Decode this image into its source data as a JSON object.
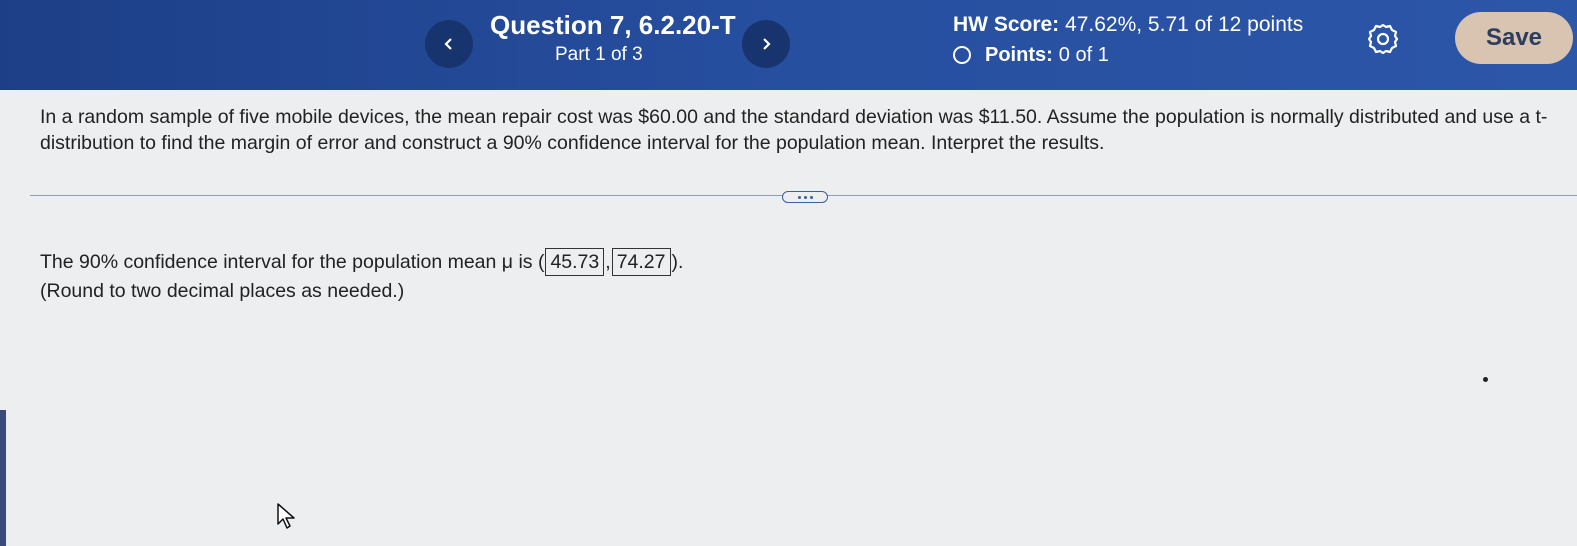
{
  "header": {
    "question_title": "Question 7, 6.2.20-T",
    "part": "Part 1 of 3",
    "hw_score_label": "HW Score:",
    "hw_score_value": "47.62%, 5.71 of 12 points",
    "points_label": "Points:",
    "points_value": "0 of 1",
    "save_label": "Save",
    "icons": {
      "prev": "chevron-left-icon",
      "next": "chevron-right-icon",
      "settings": "gear-icon",
      "points_status": "circle-outline-icon"
    }
  },
  "question": {
    "text": "In a random sample of five mobile devices, the mean repair cost was $60.00 and the standard deviation was $11.50. Assume the population is normally distributed and use a t-distribution to find the margin of error and construct a 90% confidence interval for the population mean. Interpret the results."
  },
  "answer": {
    "prefix": "The 90% confidence interval for the population mean μ is (",
    "lower": "45.73",
    "separator": ",",
    "upper": "74.27",
    "suffix": ").",
    "note": "(Round to two decimal places as needed.)"
  },
  "colors": {
    "header_bg": "#274fa0",
    "nav_btn_bg": "#17346f",
    "save_btn_bg": "#d8c4b0",
    "page_bg": "#eceeef"
  }
}
